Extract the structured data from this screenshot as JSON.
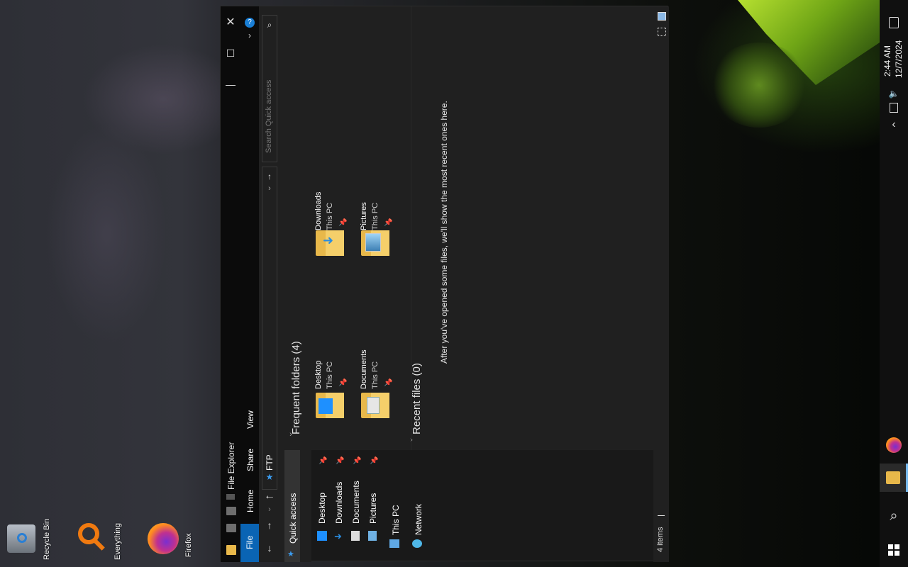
{
  "desktop": {
    "icons": [
      {
        "name": "recycle-bin",
        "label": "Recycle Bin"
      },
      {
        "name": "everything",
        "label": "Everything"
      },
      {
        "name": "firefox",
        "label": "Firefox"
      }
    ]
  },
  "taskbar": {
    "time": "2:44 AM",
    "date": "12/7/2024"
  },
  "window": {
    "title": "File Explorer",
    "close_glyph": "✕",
    "maximize_glyph": "☐",
    "minimize_glyph": "—",
    "ribbon_tabs": [
      "File",
      "Home",
      "Share",
      "View"
    ],
    "address": "FTP",
    "search_placeholder": "Search Quick access",
    "nav": {
      "quick_access": "Quick access",
      "items": [
        "Desktop",
        "Downloads",
        "Documents",
        "Pictures"
      ],
      "this_pc": "This PC",
      "network": "Network"
    },
    "content": {
      "frequent_header": "Frequent folders (4)",
      "folders": [
        {
          "name": "Desktop",
          "location": "This PC"
        },
        {
          "name": "Downloads",
          "location": "This PC"
        },
        {
          "name": "Documents",
          "location": "This PC"
        },
        {
          "name": "Pictures",
          "location": "This PC"
        }
      ],
      "recent_header": "Recent files (0)",
      "recent_empty": "After you've opened some files, we'll show the most recent ones here."
    },
    "status": {
      "items": "4 items"
    }
  },
  "colors": {
    "accent": "#0a64b4",
    "folder": "#e8b84a",
    "folder_light": "#f5cf6a",
    "window_bg": "#202020"
  }
}
